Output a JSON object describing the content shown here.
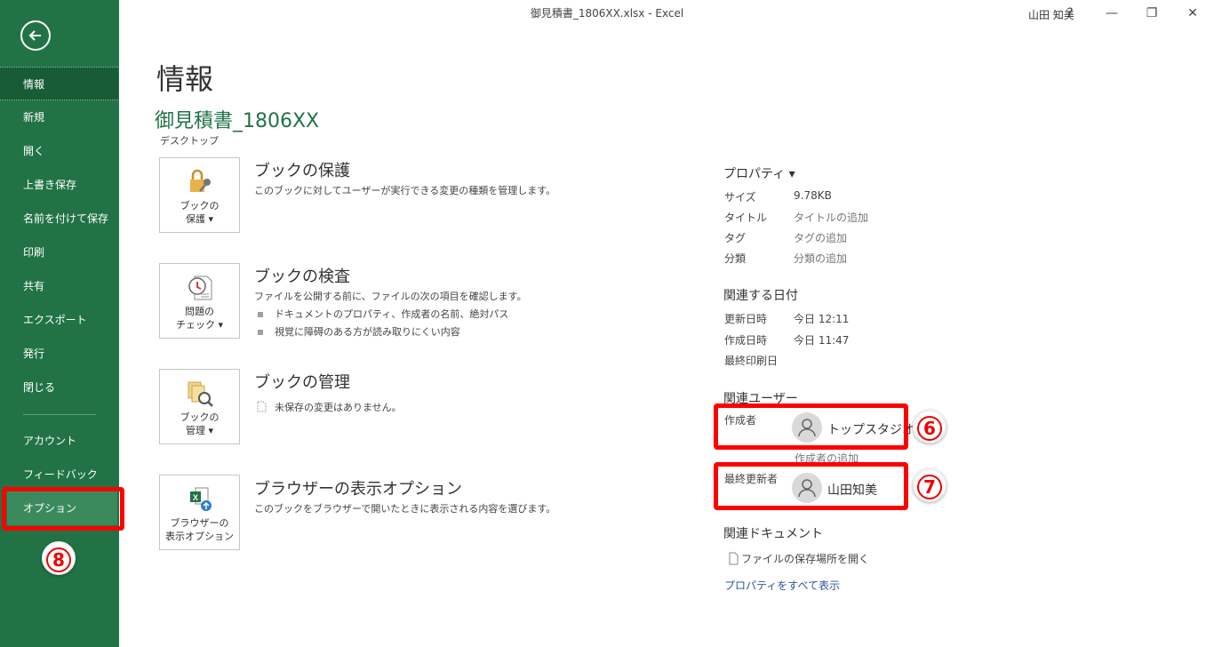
{
  "window": {
    "title": "御見積書_1806XX.xlsx  -  Excel",
    "user": "山田 知美",
    "help": "?",
    "minimize": "—",
    "restore": "❐",
    "close": "✕"
  },
  "sidebar": {
    "items": [
      {
        "label": "情報"
      },
      {
        "label": "新規"
      },
      {
        "label": "開く"
      },
      {
        "label": "上書き保存"
      },
      {
        "label": "名前を付けて保存"
      },
      {
        "label": "印刷"
      },
      {
        "label": "共有"
      },
      {
        "label": "エクスポート"
      },
      {
        "label": "発行"
      },
      {
        "label": "閉じる"
      },
      {
        "label": "アカウント"
      },
      {
        "label": "フィードバック"
      },
      {
        "label": "オプション"
      }
    ],
    "marker": "8"
  },
  "main": {
    "page_title": "情報",
    "doc_name": "御見積書_1806XX",
    "doc_location": "デスクトップ",
    "sections": [
      {
        "tile_line1": "ブックの",
        "tile_line2": "保護 ▾",
        "title": "ブックの保護",
        "desc": "このブックに対してユーザーが実行できる変更の種類を管理します。"
      },
      {
        "tile_line1": "問題の",
        "tile_line2": "チェック ▾",
        "title": "ブックの検査",
        "desc": "ファイルを公開する前に、ファイルの次の項目を確認します。",
        "bullets": [
          "ドキュメントのプロパティ、作成者の名前、絶対パス",
          "視覚に障碍のある方が読み取りにくい内容"
        ]
      },
      {
        "tile_line1": "ブックの",
        "tile_line2": "管理 ▾",
        "title": "ブックの管理",
        "desc": "未保存の変更はありません。"
      },
      {
        "tile_line1": "ブラウザーの",
        "tile_line2": "表示オプション",
        "title": "ブラウザーの表示オプション",
        "desc": "このブックをブラウザーで開いたときに表示される内容を選びます。"
      }
    ]
  },
  "properties": {
    "heading": "プロパティ ▾",
    "rows": [
      {
        "key": "サイズ",
        "value": "9.78KB"
      },
      {
        "key": "タイトル",
        "value": "タイトルの追加"
      },
      {
        "key": "タグ",
        "value": "タグの追加"
      },
      {
        "key": "分類",
        "value": "分類の追加"
      }
    ],
    "dates_heading": "関連する日付",
    "dates": [
      {
        "key": "更新日時",
        "value": "今日 12:11"
      },
      {
        "key": "作成日時",
        "value": "今日 11:47"
      },
      {
        "key": "最終印刷日",
        "value": ""
      }
    ],
    "users_heading": "関連ユーザー",
    "author_label": "作成者",
    "author_name": "トップスタジオ",
    "add_author": "作成者の追加",
    "author_marker": "6",
    "last_modified_label": "最終更新者",
    "last_modified_name": "山田知美",
    "last_modified_marker": "7",
    "docs_heading": "関連ドキュメント",
    "open_location": "ファイルの保存場所を開く",
    "show_all": "プロパティをすべて表示"
  },
  "colors": {
    "accent": "#217346",
    "marker_red": "#ff0000"
  }
}
